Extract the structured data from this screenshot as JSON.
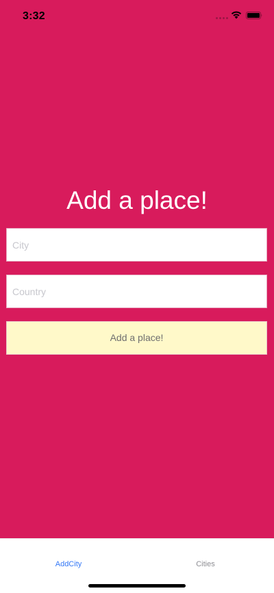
{
  "status_bar": {
    "time": "3:32",
    "icons": [
      "signal-icon",
      "wifi-icon",
      "battery-icon"
    ]
  },
  "main": {
    "title": "Add a place!",
    "city_input": {
      "placeholder": "City",
      "value": ""
    },
    "country_input": {
      "placeholder": "Country",
      "value": ""
    },
    "add_button_label": "Add a place!"
  },
  "tab_bar": {
    "tabs": [
      {
        "label": "AddCity",
        "active": true
      },
      {
        "label": "Cities",
        "active": false
      }
    ]
  },
  "colors": {
    "background": "#d81b5c",
    "button_background": "#fff9c9",
    "active_tab": "#3478f6",
    "inactive_tab": "#8e8e93"
  }
}
